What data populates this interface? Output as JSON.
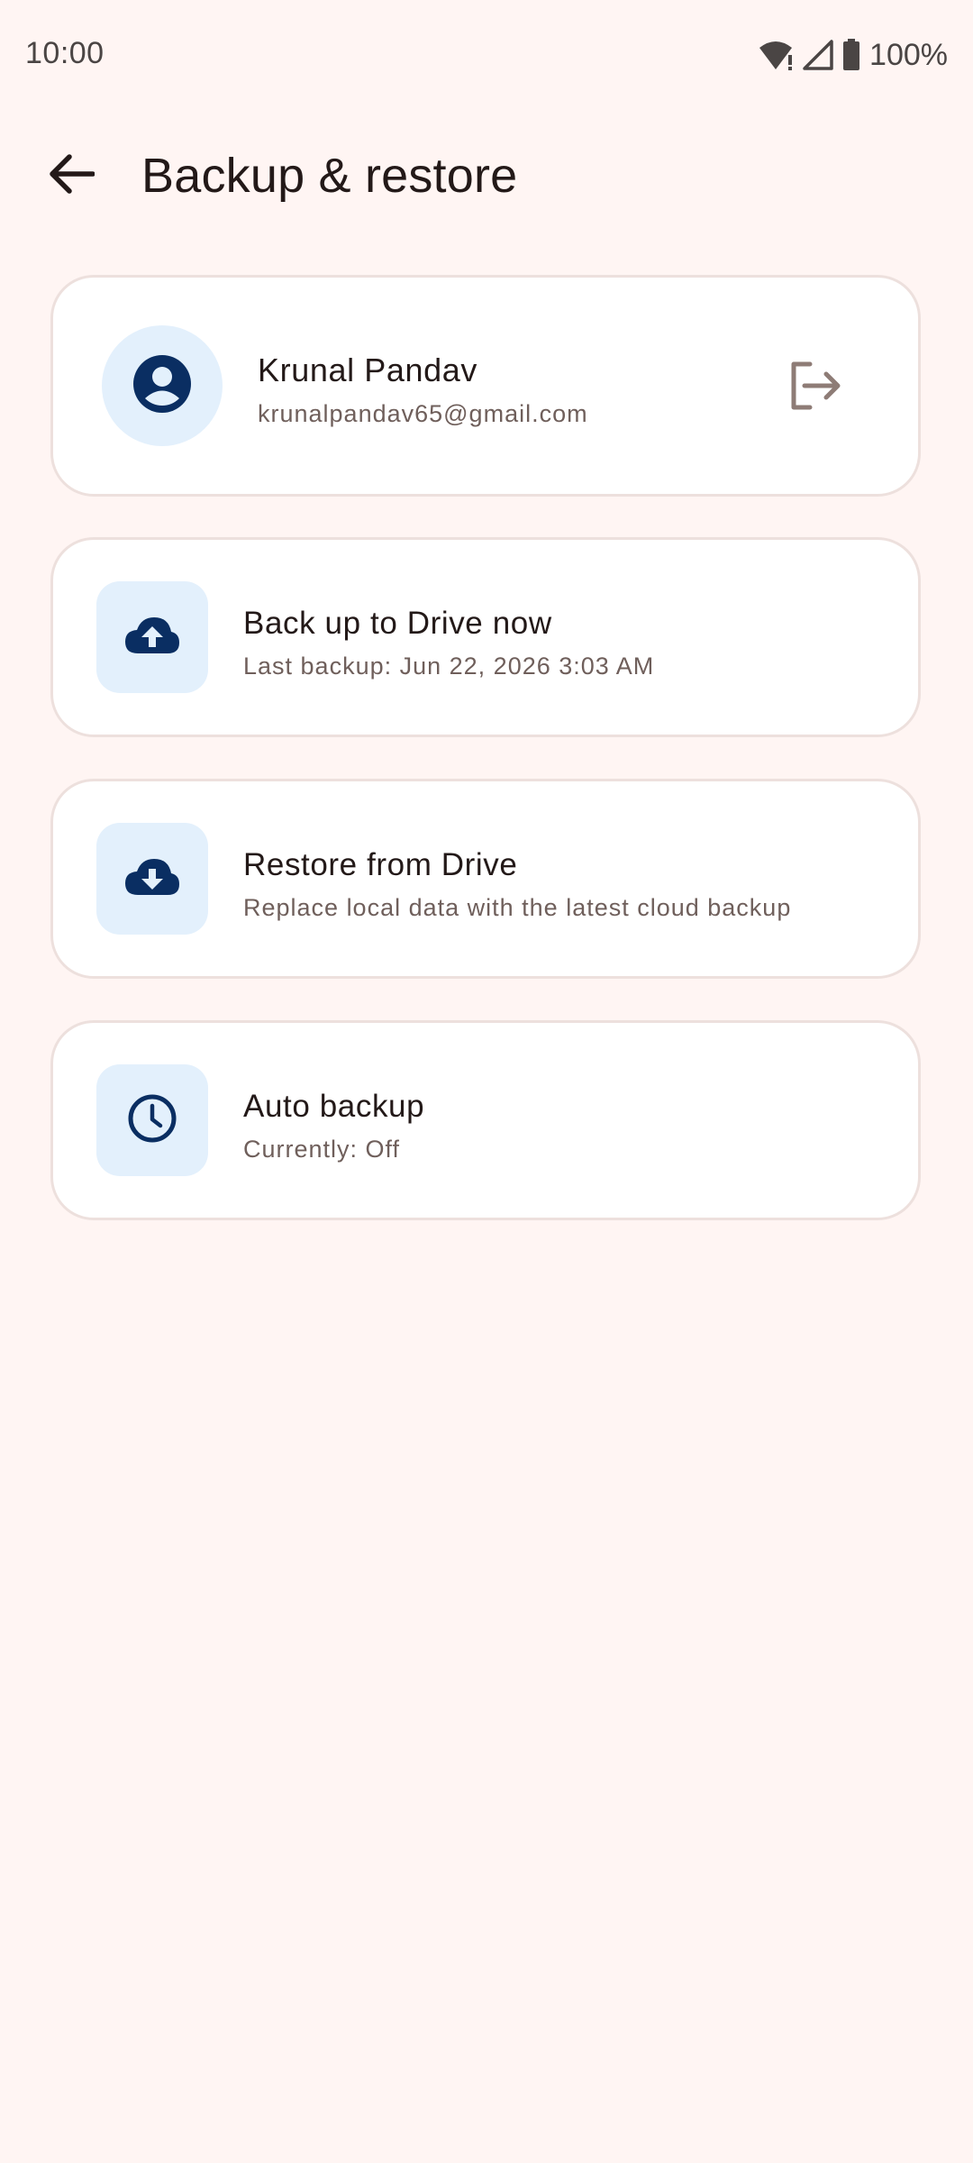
{
  "status_bar": {
    "time": "10:00",
    "battery": "100%"
  },
  "app_bar": {
    "title": "Backup & restore"
  },
  "account": {
    "name": "Krunal Pandav",
    "email": "krunalpandav65@gmail.com"
  },
  "actions": [
    {
      "title": "Back up to Drive now",
      "subtitle": "Last backup: Jun 22, 2026 3:03 AM",
      "icon": "cloud-upload-icon"
    },
    {
      "title": "Restore from Drive",
      "subtitle": "Replace local data with the latest cloud backup",
      "icon": "cloud-download-icon"
    },
    {
      "title": "Auto backup",
      "subtitle": "Currently: Off",
      "icon": "clock-icon"
    }
  ],
  "colors": {
    "background": "#fff5f3",
    "card": "#ffffff",
    "icon_tile": "#e3f0fc",
    "icon": "#0a2e62",
    "secondary_text": "#6f5f5b",
    "signout_icon": "#8e7c76"
  }
}
